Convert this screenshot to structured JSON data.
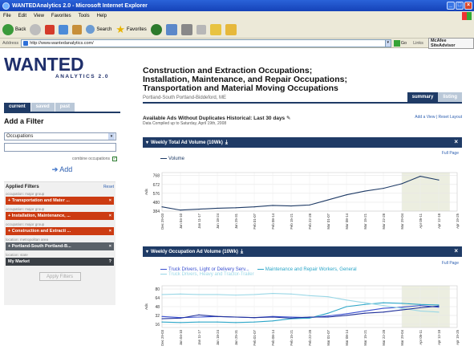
{
  "window": {
    "title": "WANTEDAnalytics 2.0 - Microsoft Internet Explorer"
  },
  "menu": [
    "File",
    "Edit",
    "View",
    "Favorites",
    "Tools",
    "Help"
  ],
  "toolbar": {
    "back": "Back",
    "search": "Search",
    "favorites": "Favorites"
  },
  "address": {
    "label": "Address",
    "url": "http://www.wantedanalytics.com/",
    "go": "Go",
    "links": "Links",
    "mcafee": "McAfee SiteAdvisor"
  },
  "logo": {
    "main": "WANTED",
    "sub": "ANALYTICS 2.0"
  },
  "sidebar": {
    "tabs": [
      "current",
      "saved",
      "past"
    ],
    "add_filter_heading": "Add a Filter",
    "filter_select": "Occupations",
    "filter_input": "",
    "combine_label": "combine occupations",
    "add_button": "Add",
    "applied_heading": "Applied Filters",
    "reset": "Reset",
    "filters": [
      {
        "category": "occupation: major group",
        "label": "Transportation and Mater ...",
        "style": "orange"
      },
      {
        "category": "occupation: major group",
        "label": "Installation, Maintenance, ...",
        "style": "orange"
      },
      {
        "category": "occupation: major group",
        "label": "Construction and Extracti ...",
        "style": "orange"
      },
      {
        "category": "location: metropolitan area",
        "label": "Portland-South Portland-B...",
        "style": "gray"
      },
      {
        "category": "location: state",
        "label": "My Market",
        "style": "dark"
      }
    ],
    "apply_button": "Apply Filters"
  },
  "main": {
    "title_lines": [
      "Construction and Extraction Occupations;",
      "Installation, Maintenance, and Repair Occupations;",
      "Transportation and Material Moving Occupations"
    ],
    "location": "Portland-South Portland-Biddeford, ME",
    "view_tabs": [
      "summary",
      "listing"
    ],
    "available_label": "Available Ads Without Duplicates Historical: Last 30 days",
    "compiled": "Data Compiled up to Saturday, April 19th, 2008",
    "layout_links": "Add a View | Reset Layout"
  },
  "panels": {
    "weekly_total": {
      "title": "Weekly Total Ad Volume (10Wk)",
      "full_page": "Full Page"
    },
    "weekly_occupation": {
      "title": "Weekly Occupation Ad Volume (10Wk)",
      "full_page": "Full Page"
    }
  },
  "colors": {
    "navy": "#1f3b66",
    "orange_chip": "#cc3b12",
    "line_navy": "#1f3b66",
    "line_teal": "#2ca6c8",
    "line_lightteal": "#9ad7e6",
    "line_blue": "#3a4fd0",
    "highlight": "#eceee0"
  },
  "icons": {
    "back": "back-arrow-icon",
    "forward": "forward-arrow-icon",
    "stop": "stop-icon",
    "refresh": "refresh-icon",
    "home": "home-icon",
    "search": "search-icon",
    "favorites": "star-icon",
    "download": "download-icon",
    "close": "close-icon"
  },
  "chart_data": [
    {
      "type": "line",
      "title": "Weekly Total Ad Volume (10Wk)",
      "categories": [
        "Dec 29-03",
        "Jan 04-10",
        "Jan 11-17",
        "Jan 18-24",
        "Jan 25-31",
        "Feb 01-07",
        "Feb 08-14",
        "Feb 15-21",
        "Feb 22-28",
        "Mar 01-07",
        "Mar 08-14",
        "Mar 15-21",
        "Mar 22-28",
        "Mar 29-04",
        "Apr 05-11",
        "Apr 12-18",
        "Apr 19-25"
      ],
      "series": [
        {
          "name": "Volume",
          "values": [
            430,
            395,
            405,
            415,
            420,
            430,
            445,
            440,
            450,
            505,
            560,
            600,
            630,
            680,
            760,
            720,
            null
          ]
        }
      ],
      "ylabel": "Ads",
      "yticks": [
        384,
        480,
        576,
        672,
        768
      ],
      "ylim": [
        384,
        800
      ],
      "highlight_range": [
        "Mar 29-04",
        "Apr 12-18"
      ],
      "grid": true,
      "legend": "top-left"
    },
    {
      "type": "line",
      "title": "Weekly Occupation Ad Volume (10Wk)",
      "categories": [
        "Dec 29-03",
        "Jan 04-10",
        "Jan 11-17",
        "Jan 18-24",
        "Jan 25-31",
        "Feb 01-07",
        "Feb 08-14",
        "Feb 15-21",
        "Feb 22-28",
        "Mar 01-07",
        "Mar 08-14",
        "Mar 15-21",
        "Mar 22-28",
        "Mar 29-04",
        "Apr 05-11",
        "Apr 12-18",
        "Apr 19-25"
      ],
      "series": [
        {
          "name": "Truck Drivers, Light or Delivery Serv...",
          "values": [
            30,
            28,
            29,
            30,
            29,
            28,
            30,
            29,
            28,
            31,
            35,
            40,
            45,
            47,
            50,
            47,
            null
          ]
        },
        {
          "name": "Maintenance and Repair Workers, General",
          "values": [
            20,
            19,
            20,
            20,
            19,
            20,
            22,
            26,
            27,
            36,
            48,
            52,
            55,
            54,
            52,
            51,
            null
          ]
        },
        {
          "name": "Truck Drivers, Heavy and Tractor-Trailer",
          "values": [
            70,
            71,
            70,
            70,
            69,
            70,
            72,
            71,
            68,
            66,
            60,
            55,
            50,
            45,
            40,
            38,
            null
          ]
        },
        {
          "name": "",
          "values": [
            26,
            27,
            33,
            30,
            29,
            28,
            29,
            27,
            29,
            29,
            32,
            36,
            38,
            42,
            46,
            49,
            null
          ]
        }
      ],
      "ylabel": "Ads",
      "yticks": [
        16,
        32,
        48,
        64,
        80
      ],
      "ylim": [
        10,
        86
      ],
      "highlight_range": [
        "Mar 29-04",
        "Apr 12-18"
      ],
      "grid": true,
      "legend": "top-left"
    }
  ]
}
